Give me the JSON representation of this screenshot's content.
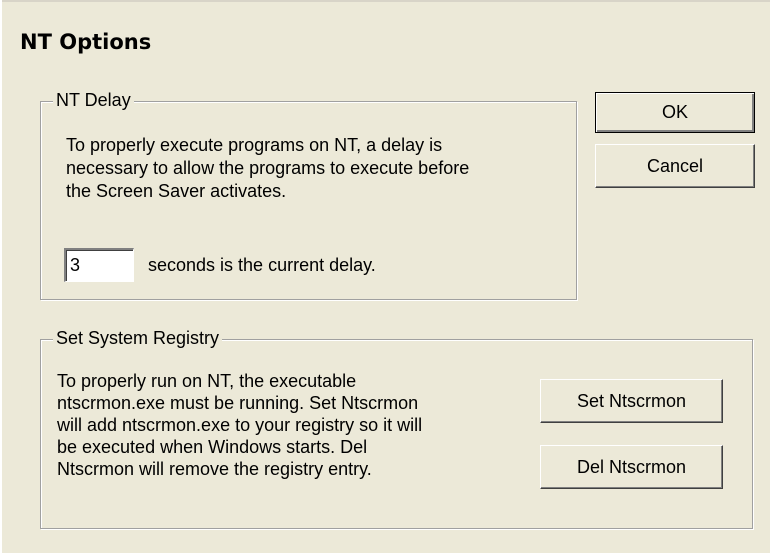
{
  "window": {
    "title": "NT Options"
  },
  "nt_delay": {
    "legend": "NT Delay",
    "description_lines": [
      "To properly execute programs on NT, a delay is",
      "necessary to allow the programs to execute before",
      "the Screen Saver activates."
    ],
    "delay_value": "3",
    "delay_suffix": "seconds is the current delay."
  },
  "buttons": {
    "ok": "OK",
    "cancel": "Cancel"
  },
  "registry": {
    "legend": "Set System Registry",
    "description_lines": [
      "To properly run on NT, the executable",
      "ntscrmon.exe must be running. Set Ntscrmon",
      "will add ntscrmon.exe to your registry so it will",
      "be executed when Windows starts. Del",
      "Ntscrmon will remove the registry entry."
    ],
    "set_button": "Set Ntscrmon",
    "del_button": "Del Ntscrmon"
  }
}
